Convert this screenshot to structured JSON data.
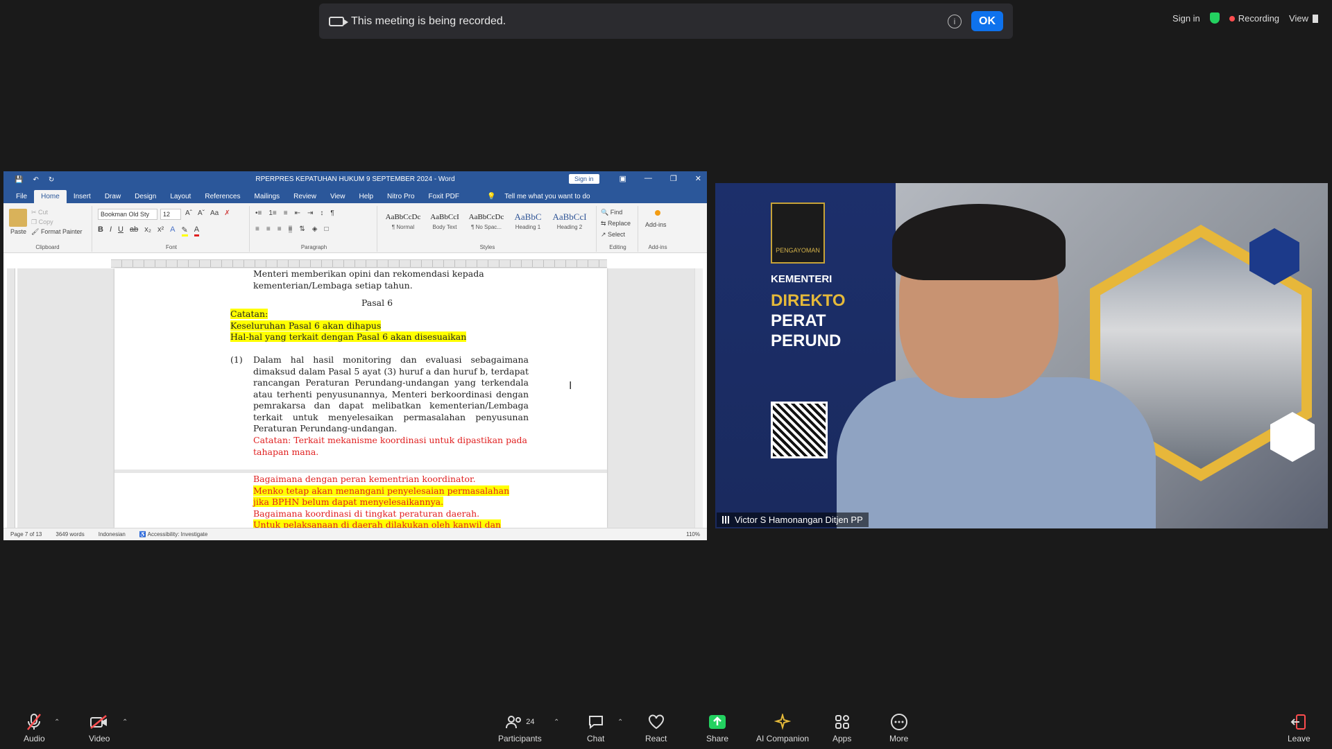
{
  "banner": {
    "message": "This meeting is being recorded.",
    "ok_label": "OK"
  },
  "top_right": {
    "sign_in": "Sign in",
    "recording": "Recording",
    "view": "View"
  },
  "word": {
    "title": "RPERPRES KEPATUHAN HUKUM 9 SEPTEMBER 2024  -  Word",
    "sign_in": "Sign in",
    "tabs": [
      "File",
      "Home",
      "Insert",
      "Draw",
      "Design",
      "Layout",
      "References",
      "Mailings",
      "Review",
      "View",
      "Help",
      "Nitro Pro",
      "Foxit PDF"
    ],
    "active_tab": "Home",
    "tell_me": "Tell me what you want to do",
    "clipboard": {
      "paste": "Paste",
      "cut": "Cut",
      "copy": "Copy",
      "format_painter": "Format Painter",
      "label": "Clipboard"
    },
    "font": {
      "name": "Bookman Old Sty",
      "size": "12",
      "label": "Font"
    },
    "paragraph_label": "Paragraph",
    "styles": [
      {
        "preview": "AaBbCcDc",
        "name": "¶ Normal"
      },
      {
        "preview": "AaBbCcI",
        "name": "Body Text"
      },
      {
        "preview": "AaBbCcDc",
        "name": "¶ No Spac..."
      },
      {
        "preview": "AaBbC",
        "name": "Heading 1"
      },
      {
        "preview": "AaBbCcI",
        "name": "Heading 2"
      }
    ],
    "styles_label": "Styles",
    "editing": {
      "find": "Find",
      "replace": "Replace",
      "select": "Select",
      "label": "Editing"
    },
    "addins": {
      "button": "Add-ins",
      "label": "Add-ins"
    },
    "document": {
      "top_lines": [
        "Menteri memberikan opini dan rekomendasi kepada",
        "kementerian/Lembaga setiap tahun."
      ],
      "pasal": "Pasal 6",
      "highlighted_notes": [
        "Catatan:",
        "Keseluruhan Pasal 6 akan dihapus",
        "Hal-hal yang terkait dengan Pasal 6 akan disesuaikan"
      ],
      "item_number": "(1)",
      "item_text": "Dalam hal hasil monitoring dan evaluasi sebagaimana dimaksud dalam Pasal 5 ayat (3) huruf a dan huruf b, terdapat rancangan Peraturan Perundang-undangan yang terkendala atau terhenti penyusunannya, Menteri berkoordinasi dengan pemrakarsa dan dapat melibatkan kementerian/Lembaga terkait untuk menyelesaikan permasalahan penyusunan Peraturan Perundang-undangan.",
      "red_note": "Catatan: Terkait mekanisme koordinasi untuk dipastikan pada tahapan mana.",
      "next_page": [
        {
          "text": "Bagaimana dengan peran kementrian koordinator.",
          "highlight": false
        },
        {
          "text": "Menko tetap akan menangani penyelesaian permasalahan",
          "highlight": true
        },
        {
          "text": "jika BPHN belum dapat menyelesaikannya.",
          "highlight": true
        },
        {
          "text": "Bagaimana koordinasi di tingkat peraturan daerah.",
          "highlight": false
        },
        {
          "text": "Untuk pelaksanaan di daerah dilakukan oleh kanwil dan",
          "highlight": true
        }
      ]
    },
    "status": {
      "page": "Page 7 of 13",
      "words": "3649 words",
      "language": "Indonesian",
      "accessibility": "Accessibility: Investigate",
      "zoom": "110%"
    }
  },
  "video": {
    "participant_name": "Victor S Hamonangan Ditjen PP",
    "logo_text": "PENGAYOMAN",
    "bg_text": {
      "kem": "KEMENTERI",
      "dir": "DIREKTO",
      "per1": "PERAT",
      "per2": "PERUND"
    }
  },
  "toolbar": {
    "audio": "Audio",
    "video": "Video",
    "participants": "Participants",
    "participants_count": "24",
    "chat": "Chat",
    "react": "React",
    "share": "Share",
    "ai_companion": "AI Companion",
    "apps": "Apps",
    "more": "More",
    "leave": "Leave"
  },
  "colors": {
    "share": "#23d160",
    "ok_button": "#0e72ed",
    "word_blue": "#2b579a",
    "highlight": "#ffff00",
    "red_text": "#e02020",
    "leave_red": "#ff4d4f"
  }
}
